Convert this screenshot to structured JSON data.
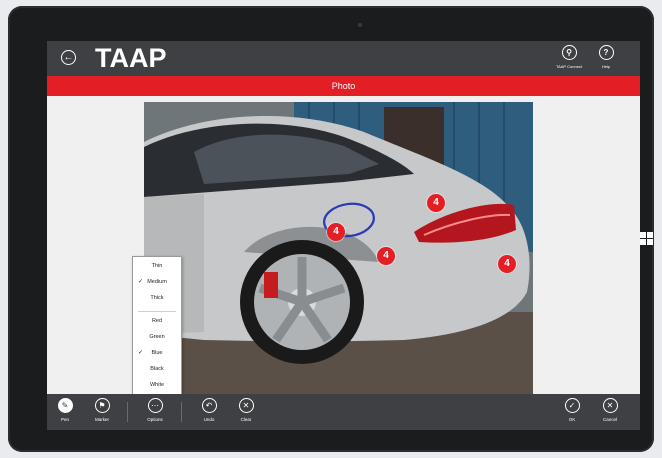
{
  "app": {
    "logo": "TAAP",
    "title": "Photo"
  },
  "header": {
    "connect_label": "TAAP Connect",
    "help_label": "Help"
  },
  "markers": [
    "4",
    "4",
    "4",
    "4"
  ],
  "menu": {
    "thicknesses": [
      {
        "label": "Thin",
        "checked": false
      },
      {
        "label": "Medium",
        "checked": true
      },
      {
        "label": "Thick",
        "checked": false
      }
    ],
    "colors": [
      {
        "label": "Red",
        "checked": false
      },
      {
        "label": "Green",
        "checked": false
      },
      {
        "label": "Blue",
        "checked": true
      },
      {
        "label": "Black",
        "checked": false
      },
      {
        "label": "White",
        "checked": false
      }
    ],
    "check_glyph": "✓"
  },
  "toolbar": {
    "pen": "Pen",
    "marker": "Marker",
    "options": "Options",
    "undo": "Undo",
    "clear": "Clear",
    "ok": "OK",
    "cancel": "Cancel"
  },
  "colors": {
    "accent": "#e31e24",
    "bar": "#3f4043",
    "pen_color": "#2a3bb5"
  }
}
